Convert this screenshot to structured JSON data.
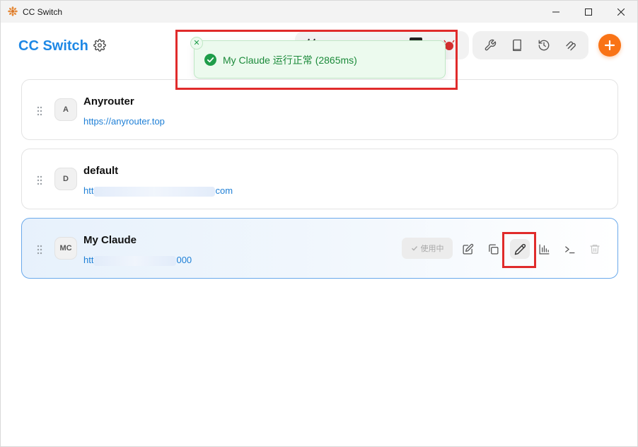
{
  "window": {
    "title": "CC Switch",
    "controls": {
      "minimize_icon": "minimize-icon",
      "maximize_icon": "maximize-icon",
      "close_icon": "close-icon"
    }
  },
  "header": {
    "brand": "CC Switch",
    "settings_icon": "gear-icon",
    "tools": [
      "wrench-icon",
      "book-icon",
      "history-icon",
      "paperclip-icon"
    ],
    "add_icon": "plus-icon"
  },
  "toast": {
    "message": "My Claude 运行正常 (2865ms)",
    "status_icon": "check-circle-icon",
    "close_icon": "close-icon",
    "accent_color": "#1b8a3a"
  },
  "providers": [
    {
      "initials": "A",
      "name": "Anyrouter",
      "url": "https://anyrouter.top",
      "active": false
    },
    {
      "initials": "D",
      "name": "default",
      "url_prefix": "htt",
      "url_suffix": "com",
      "active": false
    },
    {
      "initials": "MC",
      "name": "My Claude",
      "url_prefix": "htt",
      "url_suffix": "000",
      "active": true,
      "status_label": "使用中"
    }
  ],
  "colors": {
    "brand": "#1e88e5",
    "add_button": "#f97316",
    "highlight": "#e02b2b",
    "active_border": "#6aa9eb"
  }
}
